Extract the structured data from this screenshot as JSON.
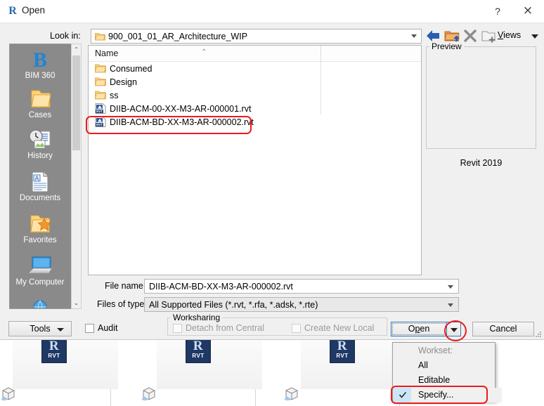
{
  "window": {
    "title": "Open",
    "app_icon": "revit-r-icon",
    "help_label": "?",
    "close_label": "×"
  },
  "lookin": {
    "label": "Look in:",
    "value": "900_001_01_AR_Architecture_WIP",
    "icon": "folder-icon"
  },
  "toolbar": {
    "back_icon": "back-arrow-icon",
    "up_icon": "up-one-level-folder-icon",
    "delete_icon": "delete-x-icon",
    "newfolder_icon": "new-folder-icon",
    "views_label": "Views",
    "views_label_prefix": "V",
    "views_label_rest": "iews"
  },
  "places": {
    "items": [
      {
        "label": "BIM 360",
        "icon": "bim360-icon"
      },
      {
        "label": "Cases",
        "icon": "folder-icon"
      },
      {
        "label": "History",
        "icon": "history-clock-icon"
      },
      {
        "label": "Documents",
        "icon": "documents-icon"
      },
      {
        "label": "Favorites",
        "icon": "favorites-star-folder-icon"
      },
      {
        "label": "My Computer",
        "icon": "my-computer-icon"
      }
    ],
    "scroll_up": "⌃",
    "scroll_down": "⌄"
  },
  "filelist": {
    "column_header": "Name",
    "sort_indicator": "⌃",
    "rows": [
      {
        "name": "Consumed",
        "type": "folder",
        "icon": "folder-icon",
        "selected": false
      },
      {
        "name": "Design",
        "type": "folder",
        "icon": "folder-icon",
        "selected": false
      },
      {
        "name": "ss",
        "type": "folder",
        "icon": "folder-icon",
        "selected": false
      },
      {
        "name": "DIIB-ACM-00-XX-M3-AR-000001.rvt",
        "type": "file",
        "icon": "rvt-file-icon",
        "selected": false
      },
      {
        "name": "DIIB-ACM-BD-XX-M3-AR-000002.rvt",
        "type": "file",
        "icon": "rvt-file-icon",
        "selected": true
      }
    ]
  },
  "fields": {
    "filename_label": "File name:",
    "filename_value": "DIIB-ACM-BD-XX-M3-AR-000002.rvt",
    "filetype_label": "Files of type:",
    "filetype_value": "All Supported Files  (*.rvt, *.rfa, *.adsk, *.rte)"
  },
  "worksharing": {
    "legend": "Worksharing",
    "detach_label": "Detach from Central",
    "detach_checked": false,
    "detach_enabled": false,
    "newlocal_label": "Create New Local",
    "newlocal_checked": false,
    "newlocal_enabled": false
  },
  "bottom": {
    "tools_label": "Tools",
    "audit_label": "Audit",
    "audit_checked": false,
    "open_label": "Open",
    "open_label_prefix": "O",
    "open_label_underlined": "p",
    "open_label_rest": "en",
    "open_split_icon": "chevron-down-icon",
    "cancel_label": "Cancel"
  },
  "preview": {
    "legend": "Preview",
    "version_text": "Revit 2019"
  },
  "workset_menu": {
    "header": "Workset:",
    "items": [
      {
        "label": "All",
        "checked": false
      },
      {
        "label": "Editable",
        "checked": false
      },
      {
        "label": "Specify...",
        "checked": true
      }
    ],
    "check_glyph": "✓"
  },
  "annotations": {
    "highlight_color": "#ef1a1a",
    "targets": [
      "selected-file-row",
      "open-split-arrow",
      "workset-specify-item"
    ]
  },
  "background": {
    "thumbnails": [
      {
        "badge_text": "RVT"
      },
      {
        "badge_text": "RVT"
      },
      {
        "badge_text": "RVT"
      }
    ],
    "badge_letter": "R"
  }
}
